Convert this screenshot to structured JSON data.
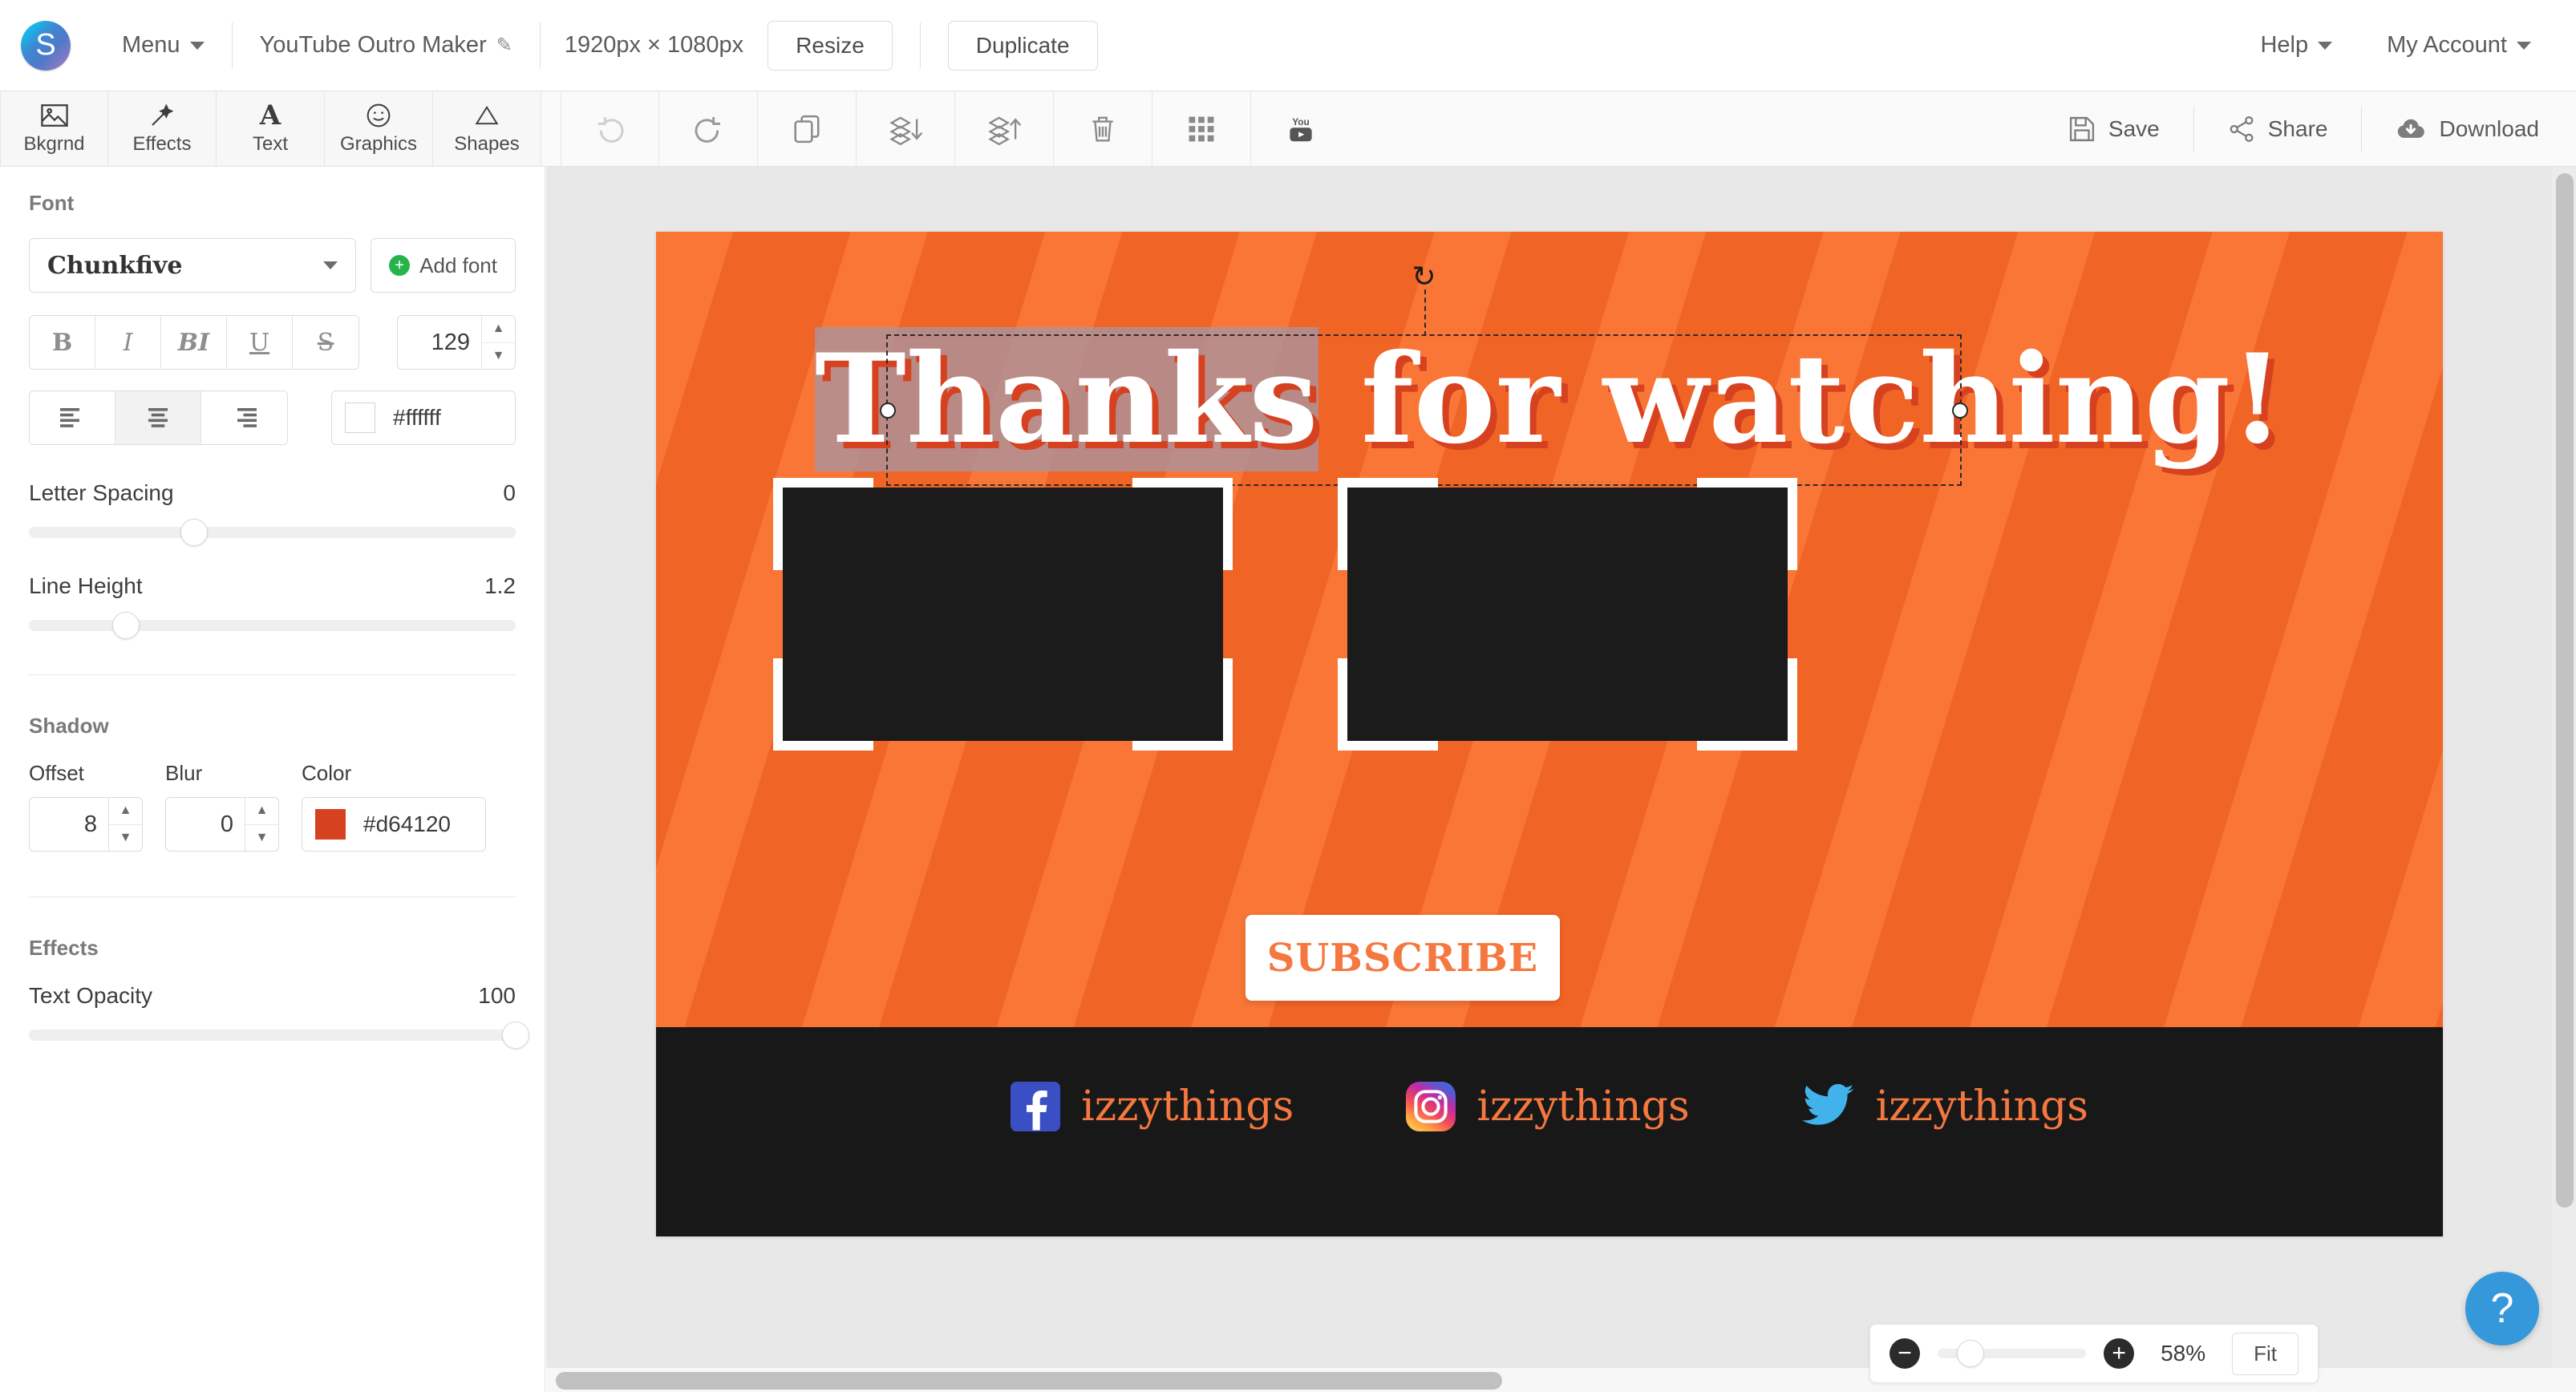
{
  "topbar": {
    "logo_letter": "S",
    "menu_label": "Menu",
    "project_title": "YouTube Outro Maker",
    "edit_icon": "pencil-icon",
    "dimensions": "1920px × 1080px",
    "resize_label": "Resize",
    "duplicate_label": "Duplicate",
    "help_label": "Help",
    "account_label": "My Account"
  },
  "toolbar": {
    "left_tools": [
      {
        "label": "Bkgrnd",
        "icon": "image-icon"
      },
      {
        "label": "Effects",
        "icon": "magic-wand-icon"
      },
      {
        "label": "Text",
        "icon": "letter-a-icon"
      },
      {
        "label": "Graphics",
        "icon": "smiley-face-icon"
      },
      {
        "label": "Shapes",
        "icon": "triangle-icon"
      }
    ],
    "action_tools": [
      {
        "name": "undo",
        "icon": "undo-arrow-icon",
        "disabled": true
      },
      {
        "name": "redo",
        "icon": "redo-arrow-icon",
        "disabled": false
      },
      {
        "name": "duplicate-layer",
        "icon": "copy-icon",
        "disabled": false
      },
      {
        "name": "send-backward",
        "icon": "layers-down-icon",
        "disabled": false
      },
      {
        "name": "bring-forward",
        "icon": "layers-up-icon",
        "disabled": false
      },
      {
        "name": "delete",
        "icon": "trash-icon",
        "disabled": false
      },
      {
        "name": "grid",
        "icon": "grid-dots-icon",
        "disabled": false
      },
      {
        "name": "youtube",
        "icon": "youtube-icon",
        "disabled": false
      }
    ],
    "right_tools": [
      {
        "label": "Save",
        "icon": "floppy-disk-icon"
      },
      {
        "label": "Share",
        "icon": "share-nodes-icon"
      },
      {
        "label": "Download",
        "icon": "cloud-download-icon"
      }
    ]
  },
  "sidebar": {
    "font_section_title": "Font",
    "font_name": "Chunkfive",
    "add_font_label": "Add font",
    "style_buttons": [
      {
        "name": "bold",
        "glyph": "B"
      },
      {
        "name": "italic",
        "glyph": "I"
      },
      {
        "name": "bold-italic",
        "glyph": "BI"
      },
      {
        "name": "underline",
        "glyph": "U"
      },
      {
        "name": "strikethrough",
        "glyph": "S"
      }
    ],
    "font_size": "129",
    "align_options": [
      {
        "name": "align-left",
        "active": false
      },
      {
        "name": "align-center",
        "active": true
      },
      {
        "name": "align-right",
        "active": false
      }
    ],
    "text_color_hex": "#ffffff",
    "letter_spacing_label": "Letter Spacing",
    "letter_spacing_value": "0",
    "line_height_label": "Line Height",
    "line_height_value": "1.2",
    "shadow_section_title": "Shadow",
    "shadow_offset_label": "Offset",
    "shadow_offset_value": "8",
    "shadow_blur_label": "Blur",
    "shadow_blur_value": "0",
    "shadow_color_label": "Color",
    "shadow_color_hex": "#d64120",
    "effects_section_title": "Effects",
    "text_opacity_label": "Text Opacity",
    "text_opacity_value": "100"
  },
  "canvas": {
    "headline_selected": "Thanks",
    "headline_rest": " for watching!",
    "subscribe_label": "SUBSCRIBE",
    "socials": [
      {
        "network": "facebook-icon",
        "handle": "izzythings"
      },
      {
        "network": "instagram-icon",
        "handle": "izzythings"
      },
      {
        "network": "twitter-icon",
        "handle": "izzythings"
      }
    ],
    "colors": {
      "orange_light": "#f97637",
      "orange_dark": "#f06426",
      "bar_dark": "#181818",
      "accent_orange": "#f4783f",
      "shadow_red": "#d64120"
    }
  },
  "zoombar": {
    "zoom_out_icon": "minus-circle-icon",
    "zoom_in_icon": "plus-circle-icon",
    "zoom_percent": "58%",
    "fit_label": "Fit"
  },
  "help_widget": {
    "glyph": "?"
  }
}
